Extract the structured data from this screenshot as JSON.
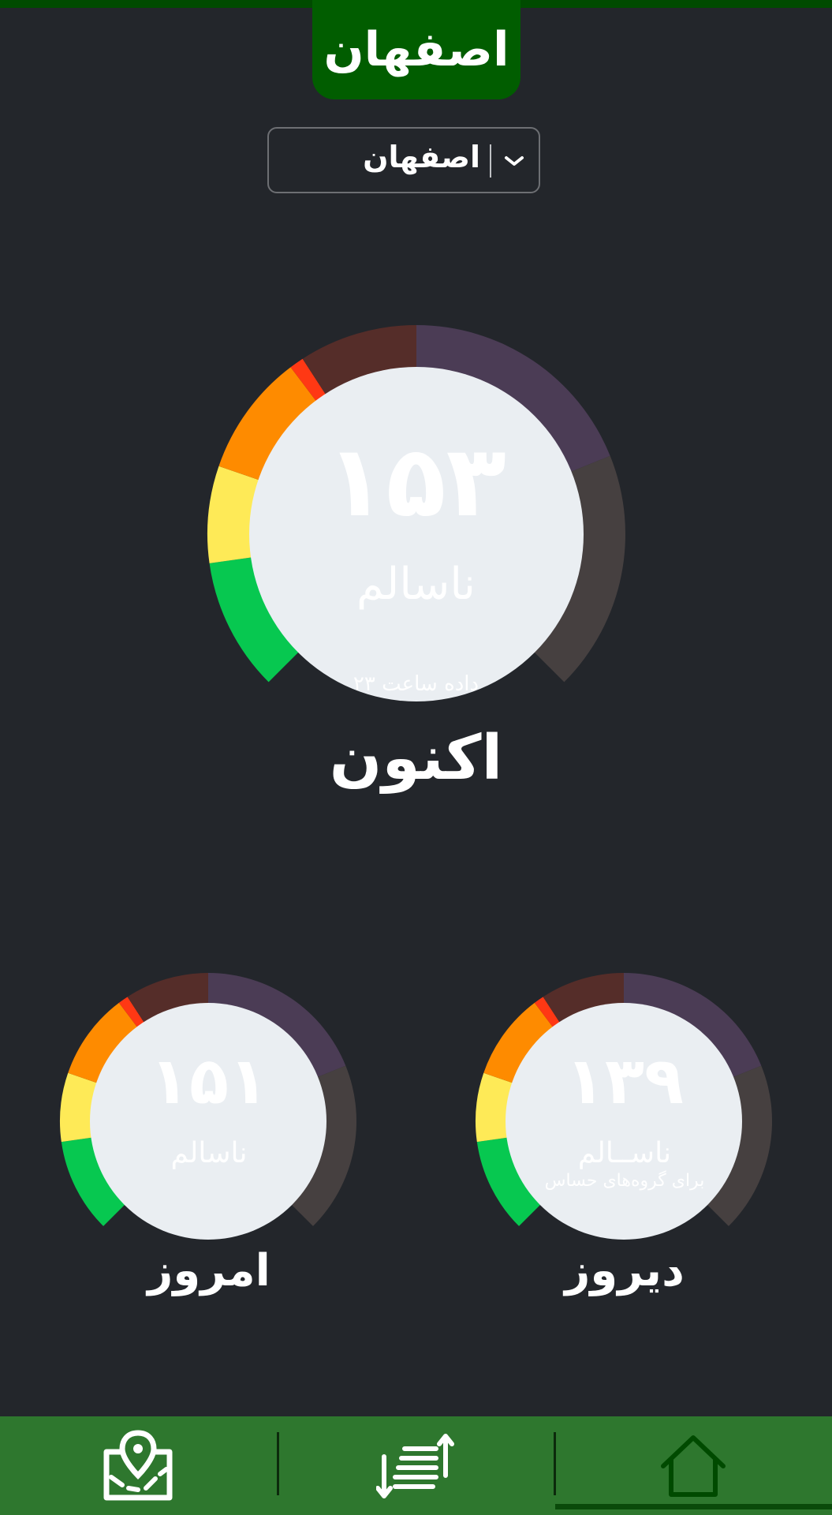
{
  "header": {
    "title": "اصفهان"
  },
  "city_select": {
    "value": "اصفهان",
    "icon": "chevron-down-icon"
  },
  "gauges": {
    "now": {
      "value": "۱۵۳",
      "status": "ناسالم",
      "subtitle": "داده ساعت ۲۳",
      "label": "اکنون"
    },
    "today": {
      "value": "۱۵۱",
      "status": "ناسالم",
      "label": "امروز"
    },
    "yesterday": {
      "value": "۱۳۹",
      "status": "ناســالم",
      "subtitle": "برای گروه‌های حساس",
      "label": "دیروز"
    }
  },
  "colors": {
    "background": "#23262b",
    "header": "#015d00",
    "nav": "#2e772e",
    "good": "#07c850",
    "moderate": "#feea57",
    "sensitive": "#fe8b00",
    "unhealthy": "#ff3814",
    "very_unhealthy": "#552d29",
    "hazardous": "#4b3c55",
    "beyond": "#464040",
    "gauge_center": "#eaeef2"
  },
  "bottom_nav": {
    "items": [
      {
        "icon": "map-pin-icon"
      },
      {
        "icon": "sort-list-icon"
      },
      {
        "icon": "home-icon",
        "active": true
      }
    ]
  }
}
